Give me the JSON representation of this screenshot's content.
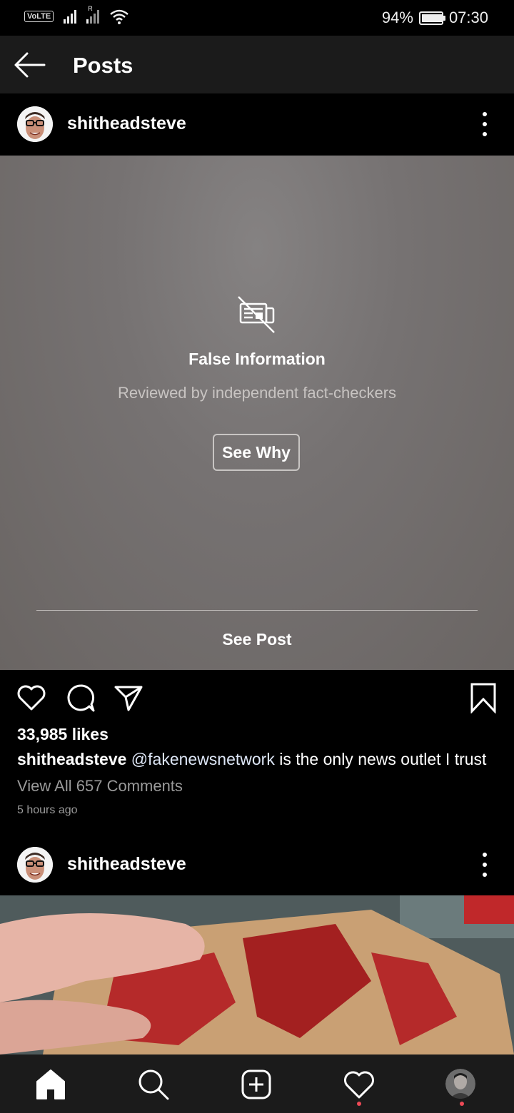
{
  "status_bar": {
    "volte": "VoLTE",
    "roaming": "R",
    "battery": "94%",
    "battery_level": 0.94,
    "time": "07:30"
  },
  "app_bar": {
    "title": "Posts",
    "back_icon": "back-arrow-icon"
  },
  "posts": [
    {
      "username": "shitheadsteve",
      "overlay": {
        "title": "False Information",
        "subtitle": "Reviewed by independent fact-checkers",
        "button": "See Why",
        "see_post": "See Post",
        "icon": "false-information-icon"
      },
      "likes": "33,985 likes",
      "caption": {
        "username": "shitheadsteve",
        "mention": "@fakenewsnetwork",
        "text": "is the only news outlet I trust"
      },
      "view_comments": "View All 657 Comments",
      "time": "5 hours ago"
    },
    {
      "username": "shitheadsteve"
    }
  ],
  "actions": [
    "heart-icon",
    "comment-icon",
    "share-icon",
    "bookmark-icon"
  ],
  "bottom_nav": [
    "home-icon",
    "search-icon",
    "add-post-icon",
    "activity-heart-icon",
    "profile-avatar"
  ],
  "colors": {
    "notification_dot": "#ed4956",
    "overlay_bg": "#767272",
    "bar_bg": "#1b1b1b"
  }
}
